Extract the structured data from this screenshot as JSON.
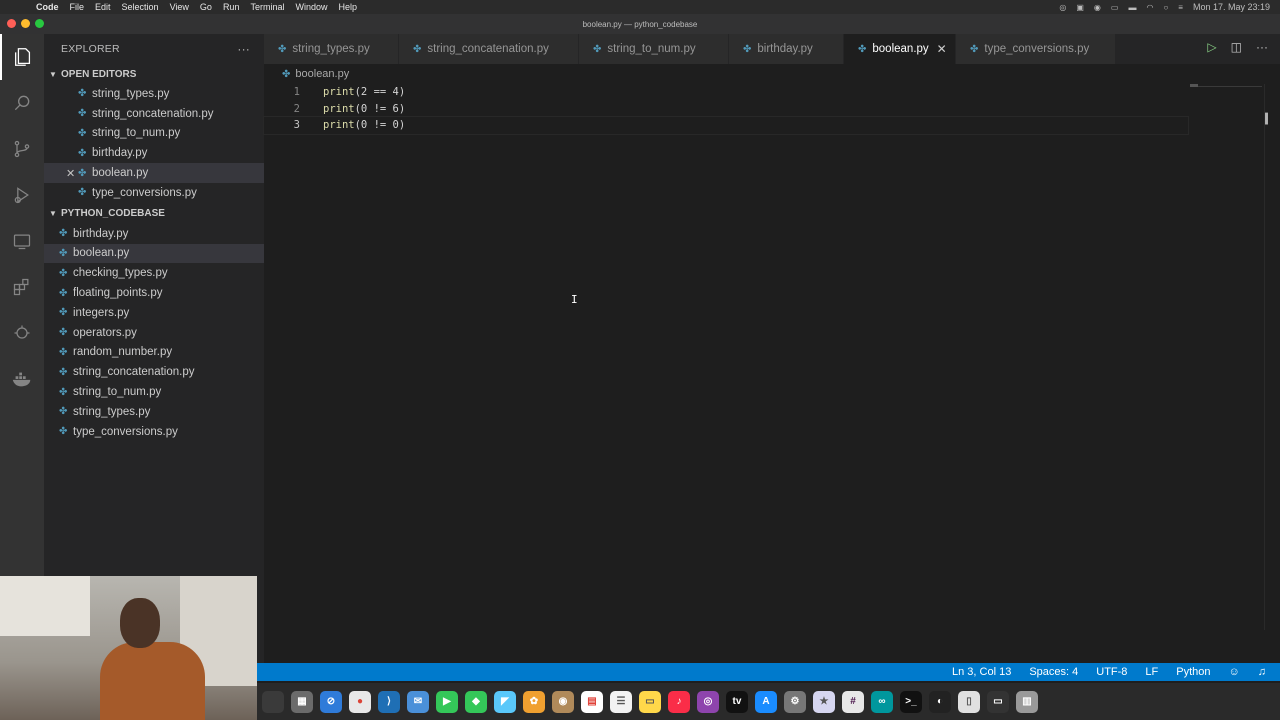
{
  "menubar": {
    "app": "Code",
    "items": [
      "File",
      "Edit",
      "Selection",
      "View",
      "Go",
      "Run",
      "Terminal",
      "Window",
      "Help"
    ],
    "clock": "Mon 17. May 23:19"
  },
  "window": {
    "title": "boolean.py — python_codebase"
  },
  "sidebar": {
    "title": "EXPLORER",
    "open_editors_label": "OPEN EDITORS",
    "open_editors": [
      "string_types.py",
      "string_concatenation.py",
      "string_to_num.py",
      "birthday.py",
      "boolean.py",
      "type_conversions.py"
    ],
    "selected_open_editor": "boolean.py",
    "project_label": "PYTHON_CODEBASE",
    "files": [
      "birthday.py",
      "boolean.py",
      "checking_types.py",
      "floating_points.py",
      "integers.py",
      "operators.py",
      "random_number.py",
      "string_concatenation.py",
      "string_to_num.py",
      "string_types.py",
      "type_conversions.py"
    ],
    "selected_file": "boolean.py"
  },
  "tabs": [
    {
      "label": "string_types.py"
    },
    {
      "label": "string_concatenation.py"
    },
    {
      "label": "string_to_num.py"
    },
    {
      "label": "birthday.py"
    },
    {
      "label": "boolean.py",
      "active": true
    },
    {
      "label": "type_conversions.py"
    }
  ],
  "breadcrumb": "boolean.py",
  "editor": {
    "lines": [
      {
        "num": "1",
        "fn": "print",
        "rest": "(2 == 4)"
      },
      {
        "num": "2",
        "fn": "print",
        "rest": "(0 != 6)"
      },
      {
        "num": "3",
        "fn": "print",
        "rest": "(0 != 0)"
      }
    ],
    "current_line": 3
  },
  "statusbar": {
    "position": "Ln 3, Col 13",
    "spaces": "Spaces: 4",
    "encoding": "UTF-8",
    "eol": "LF",
    "language": "Python"
  },
  "colors": {
    "status_bg": "#007acc",
    "python_icon": "#519aba",
    "function": "#dcdcaa"
  }
}
